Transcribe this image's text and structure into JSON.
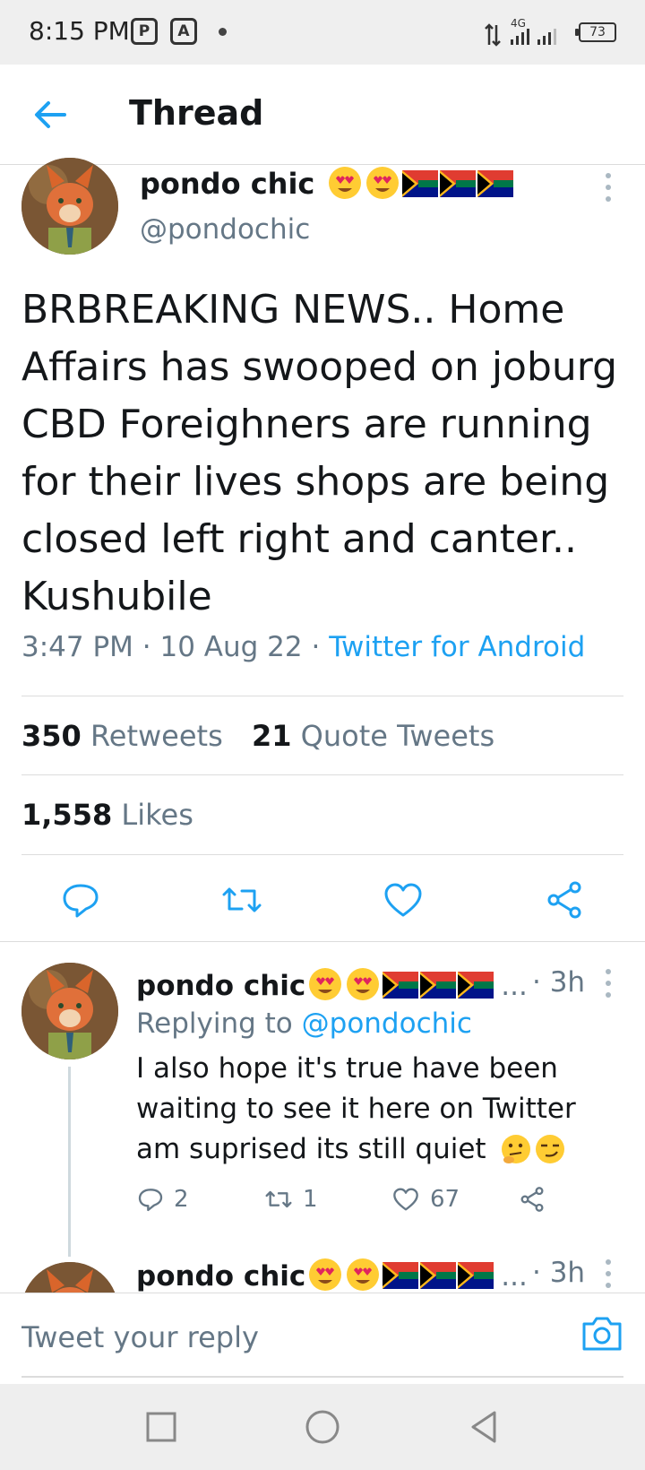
{
  "status_bar": {
    "time": "8:15 PM",
    "app_icon_1": "P",
    "app_icon_2": "A",
    "network": "4G",
    "battery": "73"
  },
  "header": {
    "title": "Thread",
    "back_icon": "arrow-left-icon"
  },
  "main_tweet": {
    "author_name": "pondo chic",
    "author_handle": "@pondochic",
    "text": "BRBREAKING NEWS.. Home Affairs has swooped on joburg CBD Foreighners are running for their lives shops are being closed left right and canter.. Kushubile",
    "time": "3:47 PM",
    "date": "10 Aug 22",
    "source": "Twitter for Android",
    "retweets_count": "350",
    "retweets_label": "Retweets",
    "quotes_count": "21",
    "quotes_label": "Quote Tweets",
    "likes_count": "1,558",
    "likes_label": "Likes"
  },
  "replies": [
    {
      "author_name": "pondo chic",
      "ellipsis": "...",
      "time": "· 3h",
      "replying_prefix": "Replying to",
      "replying_to": "@pondochic",
      "text": "I also hope it's true have been waiting to see it here on Twitter am suprised its still quiet",
      "reply_count": "2",
      "retweet_count": "1",
      "like_count": "67"
    },
    {
      "author_name": "pondo chic",
      "ellipsis": "...",
      "time": "· 3h"
    }
  ],
  "compose": {
    "placeholder": "Tweet your reply"
  },
  "colors": {
    "accent": "#1da1f2",
    "secondary_text": "#657786",
    "primary_text": "#14171a"
  }
}
